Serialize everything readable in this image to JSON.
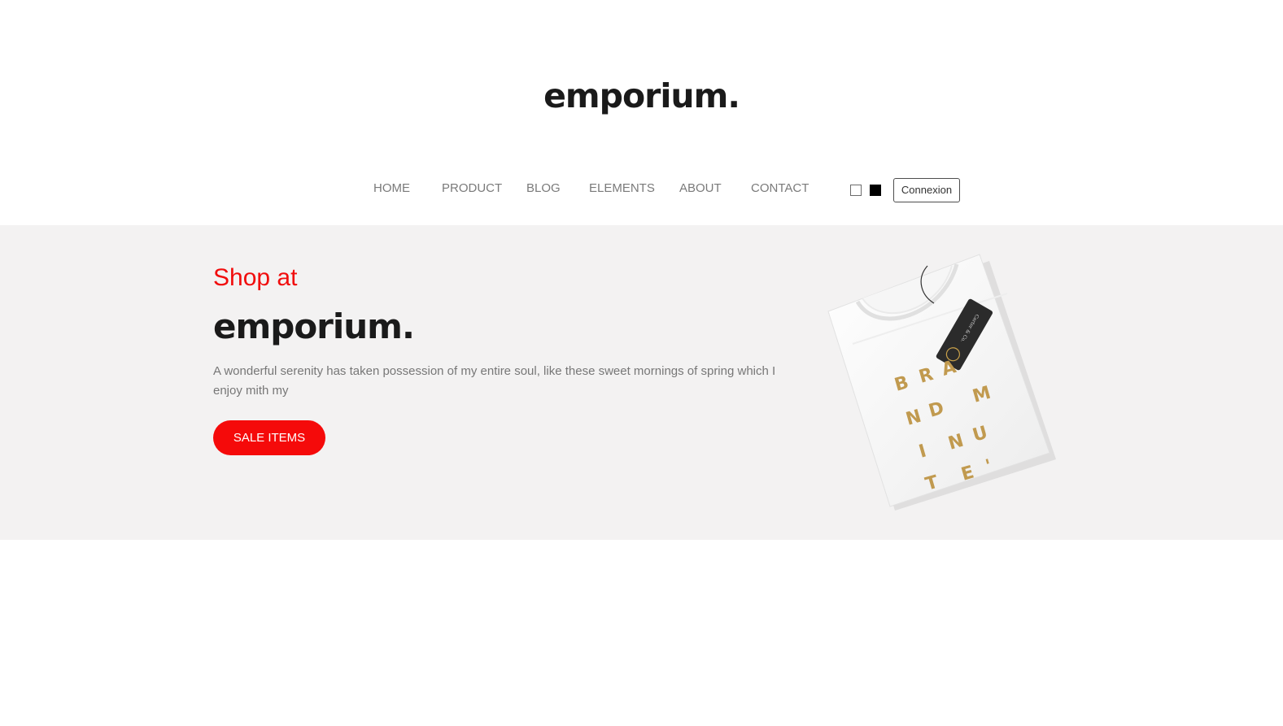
{
  "header": {
    "logo": "emporium."
  },
  "nav": {
    "items": [
      {
        "label": "HOME"
      },
      {
        "label": "PRODUCT"
      },
      {
        "label": "BLOG"
      },
      {
        "label": "ELEMENTS"
      },
      {
        "label": "ABOUT"
      },
      {
        "label": "CONTACT"
      }
    ],
    "theme_swatches": [
      "light-theme-swatch",
      "dark-theme-swatch"
    ],
    "login_button": "Connexion"
  },
  "hero": {
    "eyebrow": "Shop at",
    "title": "emporium.",
    "text": "A wonderful serenity has taken possession of my entire soul, like these sweet mornings of spring which I enjoy mith my",
    "cta": "SALE ITEMS",
    "image": {
      "description_icon": "folded-tshirt-image",
      "print_text": [
        "B",
        "R",
        "A",
        "N",
        "D",
        "M",
        "I",
        "N",
        "U",
        "T",
        "E",
        "'"
      ],
      "tag_text": "Carter & Co."
    }
  },
  "colors": {
    "accent": "#f10d0d",
    "hero_background": "#f3f2f2",
    "nav_text": "#7a7a7a",
    "logo_text": "#1a1a1a"
  }
}
